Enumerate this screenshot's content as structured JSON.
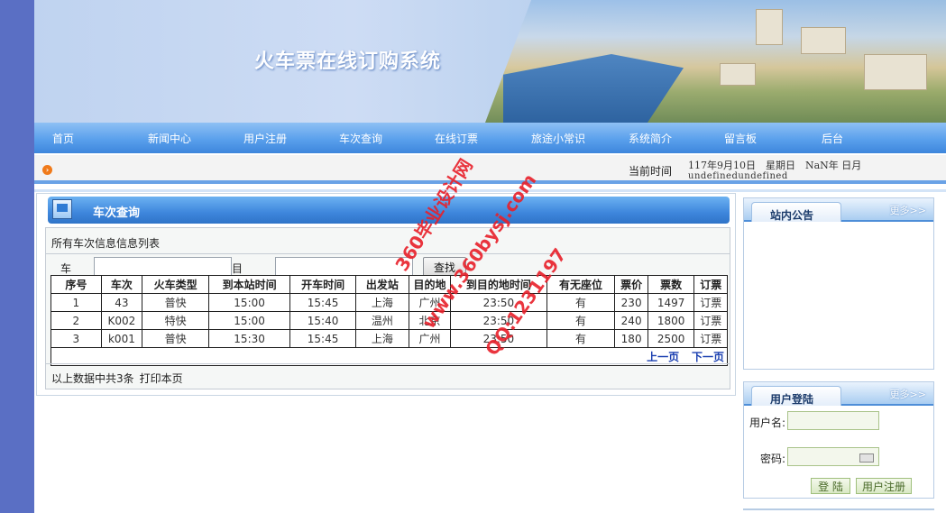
{
  "banner": {
    "title": "火车票在线订购系统"
  },
  "nav": {
    "items": [
      "首页",
      "新闻中心",
      "用户注册",
      "车次查询",
      "在线订票",
      "旅途小常识",
      "系统简介",
      "留言板",
      "后台"
    ]
  },
  "status_bar": {
    "time_label": "当前时间",
    "time_value": "117年9月10日　星期日　NaN年 日月",
    "time_extra": "undefinedundefined"
  },
  "main": {
    "title": "车次查询",
    "caption": "所有车次信息信息列表",
    "search": {
      "train_label": "车次:",
      "dest_label": "目的地:",
      "button": "查找"
    },
    "table": {
      "headers": [
        "序号",
        "车次",
        "火车类型",
        "到本站时间",
        "开车时间",
        "出发站",
        "目的地",
        "到目的地时间",
        "有无座位",
        "票价",
        "票数",
        "订票"
      ],
      "rows": [
        [
          "1",
          "43",
          "普快",
          "15:00",
          "15:45",
          "上海",
          "广州",
          "23:50",
          "有",
          "230",
          "1497",
          "订票"
        ],
        [
          "2",
          "K002",
          "特快",
          "15:00",
          "15:40",
          "温州",
          "北京",
          "23:50",
          "有",
          "240",
          "1800",
          "订票"
        ],
        [
          "3",
          "k001",
          "普快",
          "15:30",
          "15:45",
          "上海",
          "广州",
          "23:50",
          "有",
          "180",
          "2500",
          "订票"
        ]
      ],
      "prev_page": "上一页",
      "next_page": "下一页"
    },
    "footer_text": "以上数据中共3条",
    "print_link": "打印本页"
  },
  "notice": {
    "title": "站内公告",
    "more": "更多>>"
  },
  "login": {
    "title": "用户登陆",
    "more": "更多>>",
    "username_label": "用户名:",
    "password_label": "密码:",
    "login_button": "登 陆",
    "register_button": "用户注册"
  },
  "watermark": {
    "line1": "360毕业设计网",
    "line2": "www.360bysj.com",
    "line3": "QQ:1231197"
  },
  "colors": {
    "page_bg": "#5a6fc4",
    "nav_blue": "#3d86dc",
    "watermark_red": "#e8202a"
  }
}
